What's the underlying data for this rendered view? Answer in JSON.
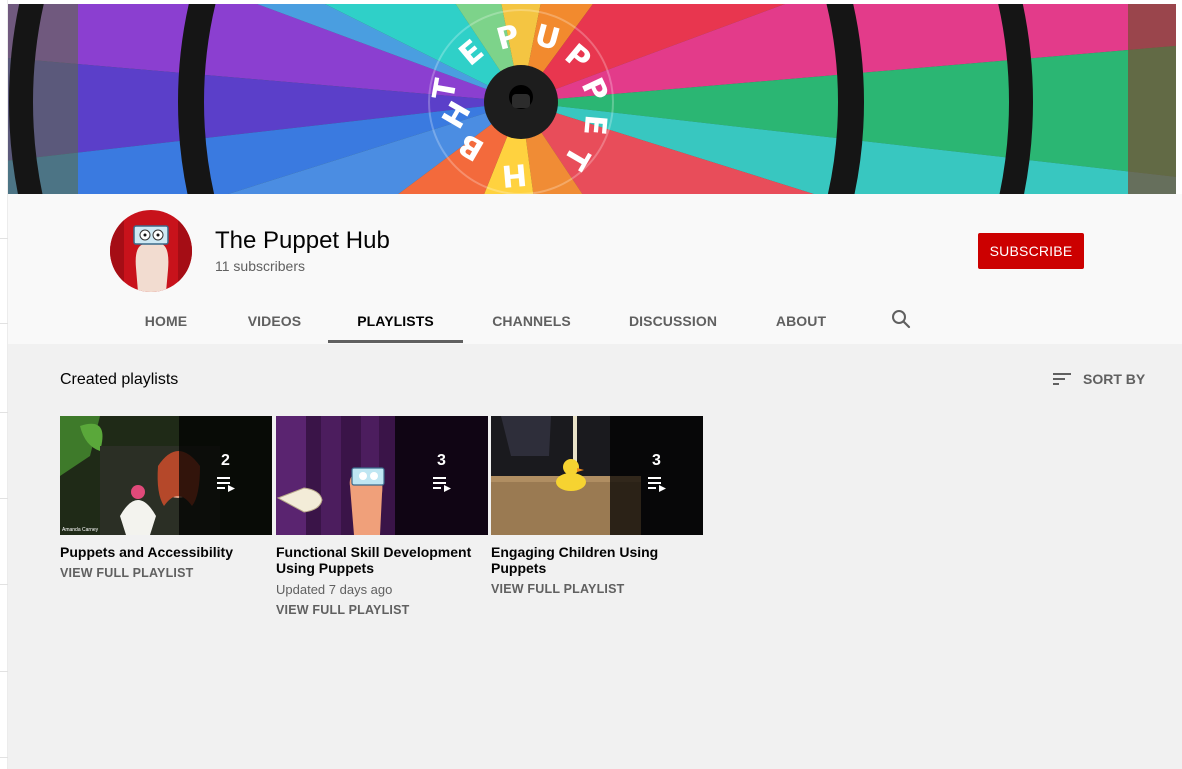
{
  "channel": {
    "name": "The Puppet Hub",
    "subscribers": "11 subscribers",
    "subscribe_label": "SUBSCRIBE",
    "banner_title": "THE PUPPET HUB"
  },
  "tabs": [
    {
      "label": "HOME",
      "active": false
    },
    {
      "label": "VIDEOS",
      "active": false
    },
    {
      "label": "PLAYLISTS",
      "active": true
    },
    {
      "label": "CHANNELS",
      "active": false
    },
    {
      "label": "DISCUSSION",
      "active": false
    },
    {
      "label": "ABOUT",
      "active": false
    }
  ],
  "tab_search_icon": "search-icon",
  "section": {
    "title": "Created playlists",
    "sort_label": "SORT BY",
    "sort_icon": "sort-icon"
  },
  "playlists": [
    {
      "title": "Puppets and Accessibility",
      "count": "2",
      "meta": "",
      "link": "VIEW FULL PLAYLIST",
      "thumb_caption": "Amanda Carney"
    },
    {
      "title": "Functional Skill Development Using Puppets",
      "count": "3",
      "meta": "Updated 7 days ago",
      "link": "VIEW FULL PLAYLIST"
    },
    {
      "title": "Engaging Children Using Puppets",
      "count": "3",
      "meta": "",
      "link": "VIEW FULL PLAYLIST"
    }
  ],
  "colors": {
    "brand_red": "#cc0000",
    "page_bg": "#f1f1f1",
    "header_bg": "#f9f9f9",
    "text_primary": "#030303",
    "text_secondary": "#606060"
  }
}
